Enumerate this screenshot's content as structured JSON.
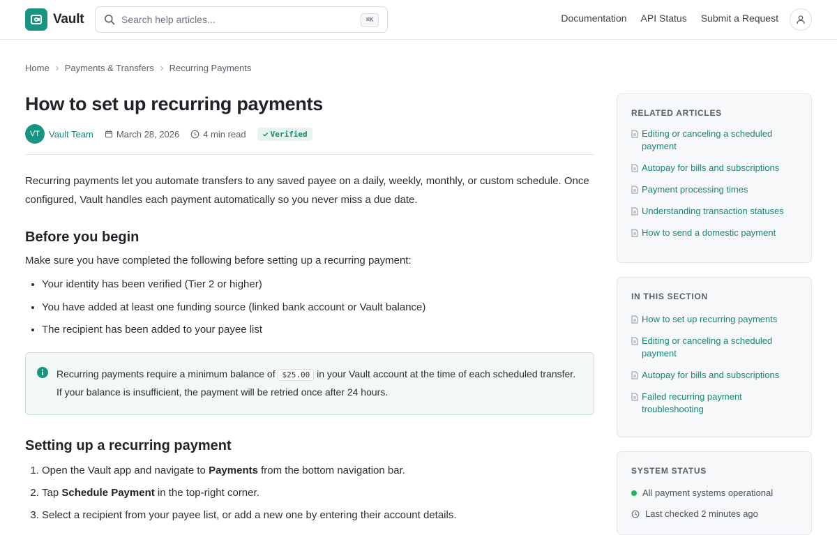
{
  "header": {
    "brand": "Vault",
    "search_placeholder": "Search help articles...",
    "shortcut": "⌘K",
    "nav": [
      "Documentation",
      "API Status",
      "Submit a Request"
    ]
  },
  "breadcrumb": [
    "Home",
    "Payments & Transfers",
    "Recurring Payments"
  ],
  "article": {
    "title": "How to set up recurring payments",
    "author_initials": "VT",
    "author": "Vault Team",
    "date": "March 28, 2026",
    "read_time": "4 min read",
    "badge": "Verified",
    "intro": "Recurring payments let you automate transfers to any saved payee on a daily, weekly, monthly, or custom schedule. Once configured, Vault handles each payment automatically so you never miss a due date.",
    "before_heading": "Before you begin",
    "before_lead": "Make sure you have completed the following before setting up a recurring payment:",
    "requirements": [
      "Your identity has been verified (Tier 2 or higher)",
      "You have added at least one funding source (linked bank account or Vault balance)",
      "The recipient has been added to your payee list"
    ],
    "callout": {
      "before": "Recurring payments require a minimum balance of",
      "amount": "$25.00",
      "after": "in your Vault account at the time of each scheduled transfer. If your balance is insufficient, the payment will be retried once after 24 hours."
    },
    "setup_heading": "Setting up a recurring payment",
    "steps": [
      {
        "a": "Open the Vault app and navigate to ",
        "b": "Payments",
        "c": " from the bottom navigation bar."
      },
      {
        "a": "Tap ",
        "b": "Schedule Payment",
        "c": " in the top-right corner."
      },
      {
        "a": "Select a recipient from your payee list, or add a new one by entering their account details.",
        "b": "",
        "c": ""
      }
    ]
  },
  "sidebar": {
    "related": {
      "title": "Related Articles",
      "links": [
        "Editing or canceling a scheduled payment",
        "Autopay for bills and subscriptions",
        "Payment processing times",
        "Understanding transaction statuses",
        "How to send a domestic payment"
      ]
    },
    "section": {
      "title": "In This Section",
      "links": [
        "How to set up recurring payments",
        "Editing or canceling a scheduled payment",
        "Autopay for bills and subscriptions",
        "Failed recurring payment troubleshooting"
      ]
    },
    "status": {
      "title": "System Status",
      "operational": "All payment systems operational",
      "last_checked": "Last checked 2 minutes ago",
      "status_color": "#22b35a"
    }
  },
  "colors": {
    "brand": "#1a9482",
    "link": "#1a8575"
  }
}
